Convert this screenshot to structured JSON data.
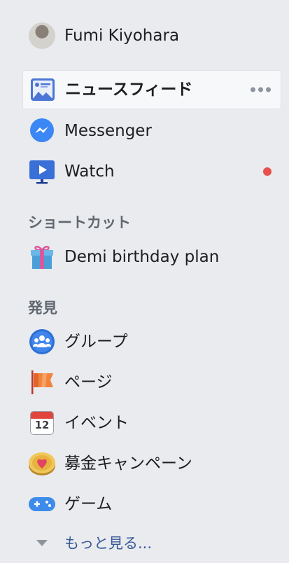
{
  "profile": {
    "name": "Fumi Kiyohara"
  },
  "nav": {
    "newsfeed": "ニュースフィード",
    "messenger": "Messenger",
    "watch": "Watch"
  },
  "shortcuts": {
    "title": "ショートカット",
    "items": [
      "Demi birthday plan"
    ]
  },
  "explore": {
    "title": "発見",
    "groups": "グループ",
    "pages": "ページ",
    "events": "イベント",
    "fundraisers": "募金キャンペーン",
    "games": "ゲーム",
    "see_more": "もっと見る...",
    "calendar_day": "12"
  },
  "colors": {
    "background": "#e9ebee",
    "link": "#385898",
    "notification": "#e8504b"
  }
}
